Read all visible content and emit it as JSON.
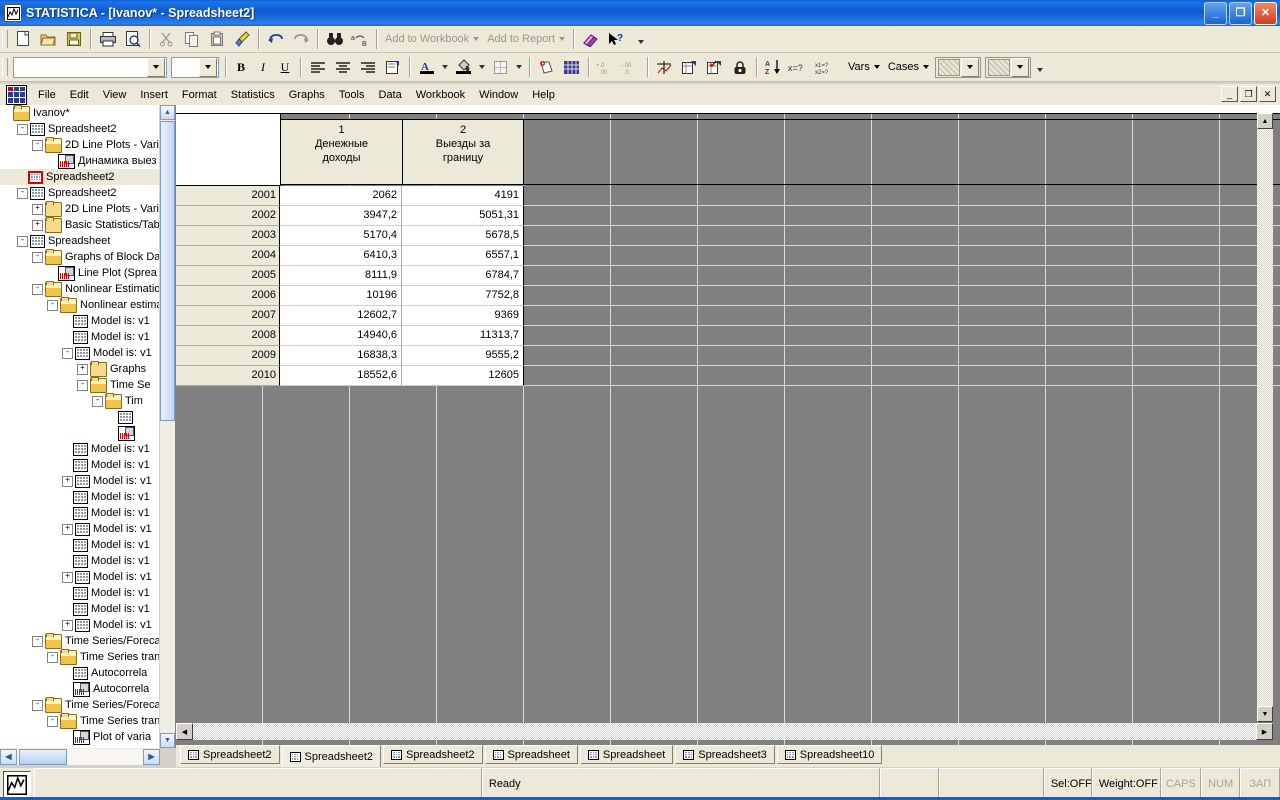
{
  "window": {
    "title": "STATISTICA - [Ivanov* - Spreadsheet2]",
    "app_icon": "statistica-icon",
    "buttons": {
      "minimize": "_",
      "restore": "❐",
      "close": "✕"
    }
  },
  "mdi": {
    "minimize": "_",
    "restore": "❐",
    "close": "✕"
  },
  "toolbar_main": {
    "buttons": [
      {
        "name": "new-document",
        "glyph": "new-icon"
      },
      {
        "name": "open-document",
        "glyph": "open-folder-icon"
      },
      {
        "name": "save-document",
        "glyph": "save-disk-icon"
      },
      {
        "name": "print",
        "glyph": "printer-icon"
      },
      {
        "name": "print-preview",
        "glyph": "print-preview-icon"
      },
      {
        "name": "cut",
        "glyph": "scissors-icon"
      },
      {
        "name": "copy",
        "glyph": "copy-icon"
      },
      {
        "name": "paste",
        "glyph": "clipboard-icon"
      },
      {
        "name": "format-painter",
        "glyph": "brush-icon"
      },
      {
        "name": "undo",
        "glyph": "undo-arrow-icon"
      },
      {
        "name": "redo",
        "glyph": "redo-arrow-icon"
      },
      {
        "name": "find",
        "glyph": "binoculars-icon"
      },
      {
        "name": "find-replace",
        "glyph": "replace-icon"
      }
    ],
    "add_to_workbook": "Add to Workbook",
    "add_to_report": "Add to Report",
    "eraser": "eraser-icon",
    "help_pointer": "help-pointer-icon"
  },
  "toolbar_format": {
    "font_name": "",
    "font_size": "",
    "bold": "B",
    "italic": "I",
    "underline": "U",
    "align_left": "align-left-icon",
    "align_center": "align-center-icon",
    "align_right": "align-right-icon",
    "cell_properties": "cell-properties-icon",
    "font_color": "A",
    "fill_color": "fill-bucket-icon",
    "borders": "borders-icon",
    "text_label": "text-label-icon",
    "grid_toggle": "grid-icon",
    "increase_decimal": "+.0",
    "decrease_decimal": "-.00",
    "variable_spec": "variable-spec-icon",
    "add_vars": "add-variable-icon",
    "check_vars": "check-variable-icon",
    "lock": "lock-icon",
    "sort_az": "sort-az-icon",
    "select_cases": "x=?",
    "case_names": "x1=? x2=?",
    "vars_menu": "Vars",
    "cases_menu": "Cases",
    "sel1": "selection-box-1",
    "sel2": "selection-box-2"
  },
  "menubar": {
    "icon": "workbook-icon",
    "items": [
      "File",
      "Edit",
      "View",
      "Insert",
      "Format",
      "Statistics",
      "Graphs",
      "Tools",
      "Data",
      "Workbook",
      "Window",
      "Help"
    ]
  },
  "tree": {
    "scroll_up": "▲",
    "scroll_down": "▼",
    "scroll_left": "◀",
    "scroll_right": "▶",
    "items": [
      {
        "indent": 0,
        "toggle": "",
        "icon": "folder-open",
        "label": "Ivanov*",
        "selected": false
      },
      {
        "indent": 1,
        "toggle": "-",
        "icon": "grid",
        "label": "Spreadsheet2",
        "selected": false
      },
      {
        "indent": 2,
        "toggle": "-",
        "icon": "folder-open",
        "label": "2D Line Plots - Varia",
        "selected": false
      },
      {
        "indent": 3,
        "toggle": "",
        "icon": "graph",
        "label": "Динамика выез",
        "selected": false
      },
      {
        "indent": 1,
        "toggle": "",
        "icon": "grid-red",
        "label": "Spreadsheet2",
        "selected": true
      },
      {
        "indent": 1,
        "toggle": "-",
        "icon": "grid",
        "label": "Spreadsheet2",
        "selected": false
      },
      {
        "indent": 2,
        "toggle": "+",
        "icon": "folder",
        "label": "2D Line Plots - Varia",
        "selected": false
      },
      {
        "indent": 2,
        "toggle": "+",
        "icon": "folder",
        "label": "Basic Statistics/Tabl",
        "selected": false
      },
      {
        "indent": 1,
        "toggle": "-",
        "icon": "grid",
        "label": "Spreadsheet",
        "selected": false
      },
      {
        "indent": 2,
        "toggle": "-",
        "icon": "folder-open",
        "label": "Graphs of Block Dat",
        "selected": false
      },
      {
        "indent": 3,
        "toggle": "",
        "icon": "graph",
        "label": "Line Plot (Sprea",
        "selected": false
      },
      {
        "indent": 2,
        "toggle": "-",
        "icon": "folder-open",
        "label": "Nonlinear Estimation",
        "selected": false
      },
      {
        "indent": 3,
        "toggle": "-",
        "icon": "folder-open",
        "label": "Nonlinear estima",
        "selected": false
      },
      {
        "indent": 4,
        "toggle": "",
        "icon": "grid",
        "label": "Model is: v1",
        "selected": false
      },
      {
        "indent": 4,
        "toggle": "",
        "icon": "grid",
        "label": "Model is: v1",
        "selected": false
      },
      {
        "indent": 4,
        "toggle": "-",
        "icon": "grid",
        "label": "Model is: v1",
        "selected": false
      },
      {
        "indent": 5,
        "toggle": "+",
        "icon": "folder",
        "label": "Graphs",
        "selected": false
      },
      {
        "indent": 5,
        "toggle": "-",
        "icon": "folder-open",
        "label": "Time Se",
        "selected": false
      },
      {
        "indent": 6,
        "toggle": "-",
        "icon": "folder-open",
        "label": "Tim",
        "selected": false
      },
      {
        "indent": 7,
        "toggle": "",
        "icon": "grid",
        "label": "",
        "selected": false
      },
      {
        "indent": 7,
        "toggle": "",
        "icon": "graph",
        "label": "",
        "selected": false
      },
      {
        "indent": 4,
        "toggle": "",
        "icon": "grid",
        "label": "Model is: v1",
        "selected": false
      },
      {
        "indent": 4,
        "toggle": "",
        "icon": "grid",
        "label": "Model is: v1",
        "selected": false
      },
      {
        "indent": 4,
        "toggle": "+",
        "icon": "grid",
        "label": "Model is: v1",
        "selected": false
      },
      {
        "indent": 4,
        "toggle": "",
        "icon": "grid",
        "label": "Model is: v1",
        "selected": false
      },
      {
        "indent": 4,
        "toggle": "",
        "icon": "grid",
        "label": "Model is: v1",
        "selected": false
      },
      {
        "indent": 4,
        "toggle": "+",
        "icon": "grid",
        "label": "Model is: v1",
        "selected": false
      },
      {
        "indent": 4,
        "toggle": "",
        "icon": "grid",
        "label": "Model is: v1",
        "selected": false
      },
      {
        "indent": 4,
        "toggle": "",
        "icon": "grid",
        "label": "Model is: v1",
        "selected": false
      },
      {
        "indent": 4,
        "toggle": "+",
        "icon": "grid",
        "label": "Model is: v1",
        "selected": false
      },
      {
        "indent": 4,
        "toggle": "",
        "icon": "grid",
        "label": "Model is: v1",
        "selected": false
      },
      {
        "indent": 4,
        "toggle": "",
        "icon": "grid",
        "label": "Model is: v1",
        "selected": false
      },
      {
        "indent": 4,
        "toggle": "+",
        "icon": "grid",
        "label": "Model is: v1",
        "selected": false
      },
      {
        "indent": 2,
        "toggle": "-",
        "icon": "folder-open",
        "label": "Time Series/Forecas",
        "selected": false
      },
      {
        "indent": 3,
        "toggle": "-",
        "icon": "folder-open",
        "label": "Time Series tran",
        "selected": false
      },
      {
        "indent": 4,
        "toggle": "",
        "icon": "grid",
        "label": "Autocorrela",
        "selected": false
      },
      {
        "indent": 4,
        "toggle": "",
        "icon": "graph",
        "label": "Autocorrela",
        "selected": false
      },
      {
        "indent": 2,
        "toggle": "-",
        "icon": "folder-open",
        "label": "Time Series/Forecas",
        "selected": false
      },
      {
        "indent": 3,
        "toggle": "-",
        "icon": "folder-open",
        "label": "Time Series tran",
        "selected": false
      },
      {
        "indent": 4,
        "toggle": "",
        "icon": "graph",
        "label": "Plot of varia",
        "selected": false
      }
    ]
  },
  "spreadsheet": {
    "columns": [
      {
        "num": "1",
        "name_line1": "Денежные",
        "name_line2": "доходы"
      },
      {
        "num": "2",
        "name_line1": "Выезды за",
        "name_line2": "границу"
      }
    ],
    "rows": [
      {
        "header": "2001",
        "values": [
          "2062",
          "4191"
        ]
      },
      {
        "header": "2002",
        "values": [
          "3947,2",
          "5051,31"
        ]
      },
      {
        "header": "2003",
        "values": [
          "5170,4",
          "5678,5"
        ]
      },
      {
        "header": "2004",
        "values": [
          "6410,3",
          "6557,1"
        ]
      },
      {
        "header": "2005",
        "values": [
          "8111,9",
          "6784,7"
        ]
      },
      {
        "header": "2006",
        "values": [
          "10196",
          "7752,8"
        ]
      },
      {
        "header": "2007",
        "values": [
          "12602,7",
          "9369"
        ]
      },
      {
        "header": "2008",
        "values": [
          "14940,6",
          "11313,7"
        ]
      },
      {
        "header": "2009",
        "values": [
          "16838,3",
          "9555,2"
        ]
      },
      {
        "header": "2010",
        "values": [
          "18552,6",
          "12605"
        ]
      }
    ]
  },
  "tabs": [
    {
      "label": "Spreadsheet2",
      "active": false
    },
    {
      "label": "Spreadsheet2",
      "active": true
    },
    {
      "label": "Spreadsheet2",
      "active": false
    },
    {
      "label": "Spreadsheet",
      "active": false
    },
    {
      "label": "Spreadsheet",
      "active": false
    },
    {
      "label": "Spreadsheet3",
      "active": false
    },
    {
      "label": "Spreadsheet10",
      "active": false
    }
  ],
  "statusbar": {
    "taskbar_icon": "statistica-icon",
    "ready": "Ready",
    "panel_a": "",
    "panel_b": "",
    "sel": "Sel:OFF",
    "weight": "Weight:OFF",
    "caps": "CAPS",
    "num": "NUM",
    "zap": "ЗАП"
  },
  "colors": {
    "titlebar": "#1560c8",
    "chrome": "#ece9d8",
    "grid_inactive": "#808080",
    "header_fill": "#ece9d8",
    "selection": "#d00000"
  }
}
